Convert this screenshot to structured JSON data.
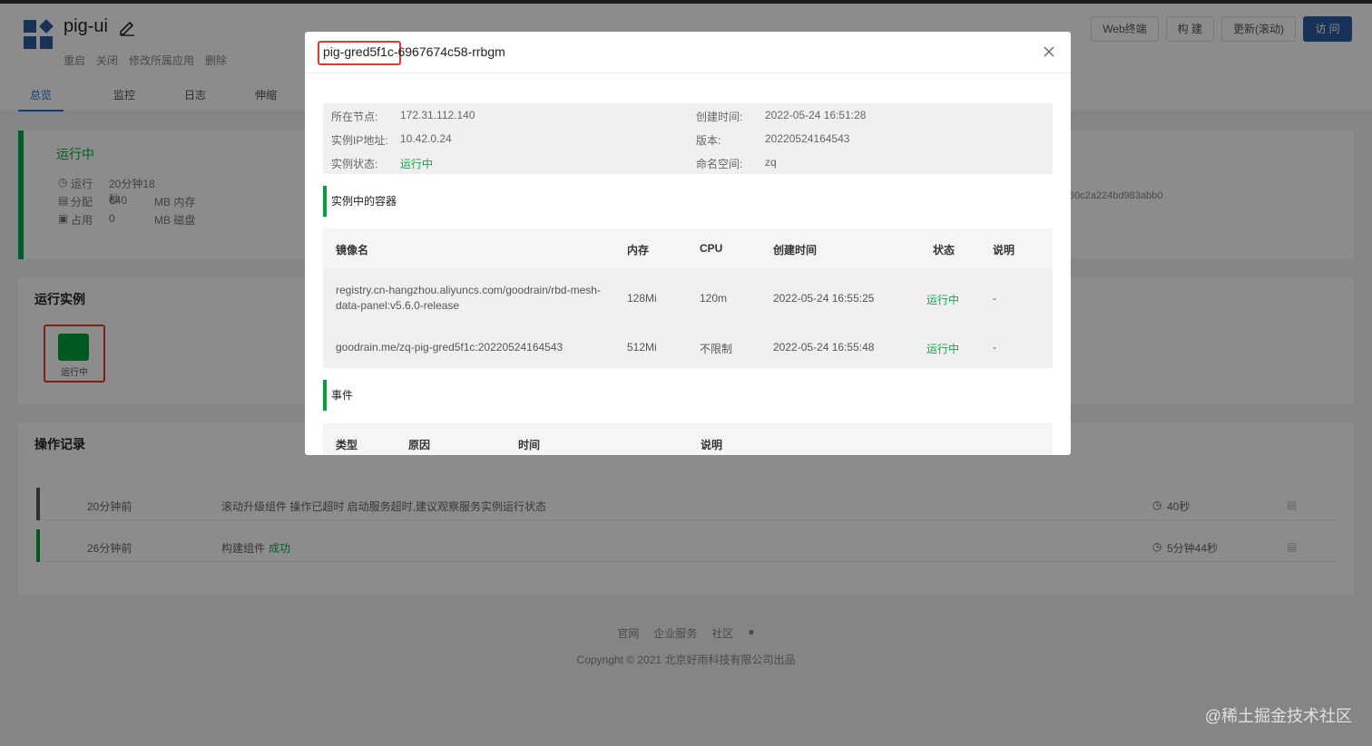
{
  "app": {
    "name": "pig-ui",
    "actions": [
      "重启",
      "关闭",
      "修改所属应用",
      "删除"
    ],
    "tabs": [
      "总览",
      "监控",
      "日志",
      "伸缩"
    ],
    "buttons": [
      "Web终端",
      "构 建",
      "更新(滚动)",
      "访 问"
    ]
  },
  "status": {
    "title": "运行中",
    "rows": [
      {
        "icon": "clock-icon",
        "label": "运行",
        "value": "20分钟18秒",
        "unit": ""
      },
      {
        "icon": "file-icon",
        "label": "分配",
        "value": "640",
        "unit": "MB 内存"
      },
      {
        "icon": "disk-icon",
        "label": "占用",
        "value": "0",
        "unit": "MB 磁盘"
      }
    ],
    "hash_fragment": "60c2a224bd983abb0"
  },
  "instances": {
    "title": "运行实例",
    "item_label": "运行中"
  },
  "ops": {
    "title": "操作记录",
    "rows": [
      {
        "time": "20分钟前",
        "text": "滚动升级组件 操作已超时 启动服务超时,建议观察服务实例运行状态",
        "result": "",
        "duration": "40秒",
        "bar": "#555555"
      },
      {
        "time": "26分钟前",
        "text": "构建组件",
        "result": "成功",
        "duration": "5分钟44秒",
        "bar": "#00a23c"
      }
    ]
  },
  "footer": {
    "links": [
      "官网",
      "企业服务",
      "社区"
    ],
    "copyright": "Copyright © 2021 北京好雨科技有限公司出品"
  },
  "watermark": "@稀土掘金技术社区",
  "modal": {
    "title": "pig-gred5f1c-6967674c58-rrbgm",
    "info": [
      {
        "l1": "所在节点:",
        "v1": "172.31.112.140",
        "l2": "创建时间:",
        "v2": "2022-05-24 16:51:28"
      },
      {
        "l1": "实例IP地址:",
        "v1": "10.42.0.24",
        "l2": "版本:",
        "v2": "20220524164543"
      },
      {
        "l1": "实例状态:",
        "v1": "运行中",
        "l2": "命名空间:",
        "v2": "zq"
      }
    ],
    "containers_title": "实例中的容器",
    "containers_headers": [
      "镜像名",
      "内存",
      "CPU",
      "创建时间",
      "状态",
      "说明"
    ],
    "containers": [
      {
        "image": "registry.cn-hangzhou.aliyuncs.com/goodrain/rbd-mesh-data-panel:v5.6.0-release",
        "memory": "128Mi",
        "cpu": "120m",
        "created": "2022-05-24 16:55:25",
        "status": "运行中",
        "note": "-"
      },
      {
        "image": "goodrain.me/zq-pig-gred5f1c:20220524164543",
        "memory": "512Mi",
        "cpu": "不限制",
        "created": "2022-05-24 16:55:48",
        "status": "运行中",
        "note": "-"
      }
    ],
    "events_title": "事件",
    "events_headers": [
      "类型",
      "原因",
      "时间",
      "说明"
    ]
  }
}
